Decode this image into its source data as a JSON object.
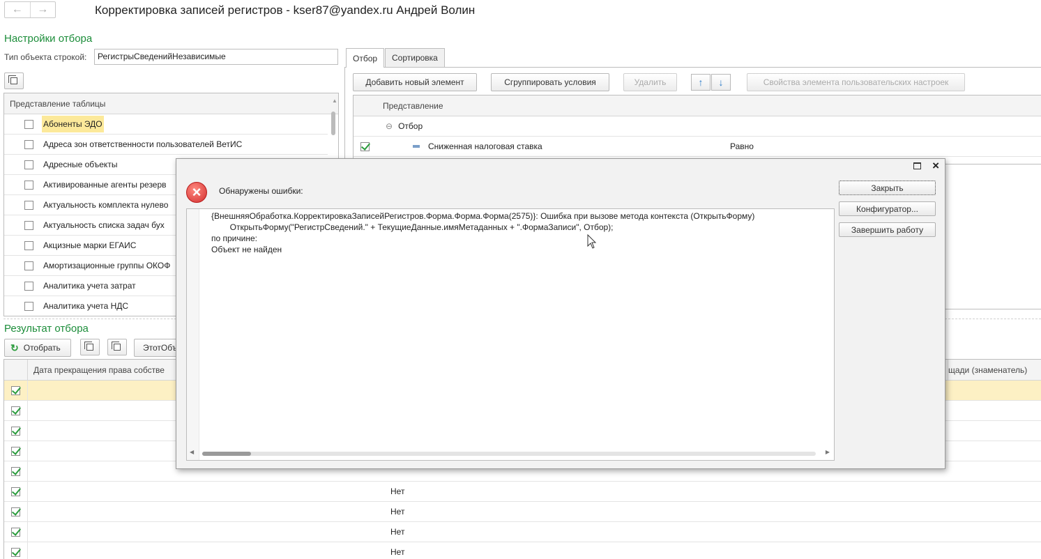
{
  "window": {
    "title": "Корректировка записей регистров - kser87@yandex.ru Андрей Волин"
  },
  "nav": {
    "back_icon": "arrow-left-icon",
    "forward_icon": "arrow-right-icon"
  },
  "filter_settings": {
    "section_title": "Настройки отбора",
    "object_type_label": "Тип объекта строкой:",
    "object_type_value": "РегистрыСведенийНезависимые",
    "table_header": "Представление таблицы",
    "items": [
      {
        "label": "Абоненты ЭДО",
        "checked": false,
        "highlight": true
      },
      {
        "label": "Адреса зон ответственности пользователей ВетИС",
        "checked": false
      },
      {
        "label": "Адресные объекты",
        "checked": false
      },
      {
        "label": "Активированные агенты резерв",
        "checked": false
      },
      {
        "label": "Актуальность комплекта нулево",
        "checked": false
      },
      {
        "label": "Актуальность списка задач бух",
        "checked": false
      },
      {
        "label": "Акцизные марки ЕГАИС",
        "checked": false
      },
      {
        "label": "Амортизационные группы ОКОФ",
        "checked": false
      },
      {
        "label": "Аналитика учета затрат",
        "checked": false
      },
      {
        "label": "Аналитика учета НДС",
        "checked": false
      }
    ]
  },
  "tabs": [
    {
      "label": "Отбор",
      "active": true
    },
    {
      "label": "Сортировка",
      "active": false
    }
  ],
  "filter_toolbar": {
    "add": "Добавить новый элемент",
    "group": "Сгруппировать условия",
    "delete": "Удалить",
    "props": "Свойства элемента пользовательских настроек"
  },
  "filter_tree": {
    "header": "Представление",
    "group_label": "Отбор",
    "condition_label": "Сниженная налоговая ставка",
    "condition_type": "Равно"
  },
  "result": {
    "section_title": "Результат отбора",
    "select_button": "Отобрать",
    "this_object_button": "ЭтотОбъ",
    "col_date": "Дата прекращения права собстве",
    "col_area": "щади (знаменатель)",
    "rows": [
      "",
      "",
      "",
      "",
      "",
      "Нет",
      "Нет",
      "Нет",
      "Нет",
      "Нет"
    ]
  },
  "dialog": {
    "message": "Обнаружены ошибки:",
    "lines": [
      "{ВнешняяОбработка.КорректировкаЗаписейРегистров.Форма.Форма.Форма(2575)}: Ошибка при вызове метода контекста (ОткрытьФорму)",
      "        ОткрытьФорму(\"РегистрСведений.\" + ТекущиеДанные.имяМетаданных + \".ФормаЗаписи\", Отбор);",
      "по причине:",
      "Объект не найден"
    ],
    "close_button": "Закрыть",
    "configurator_button": "Конфигуратор...",
    "exit_button": "Завершить работу"
  }
}
